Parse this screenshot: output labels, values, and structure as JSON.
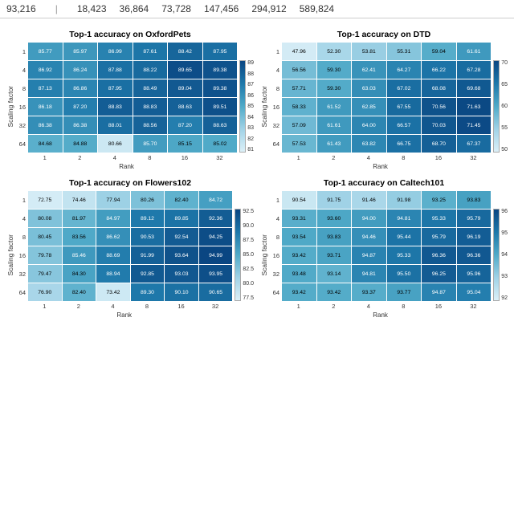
{
  "header": {
    "numbers": [
      "93,216",
      "18,423",
      "36,864",
      "73,728",
      "147,456",
      "294,912",
      "589,824"
    ]
  },
  "charts": [
    {
      "id": "oxfordpets",
      "title": "Top-1 accuracy on OxfordPets",
      "yLabel": "Scaling factor",
      "xLabel": "Rank",
      "rowLabels": [
        "1",
        "4",
        "8",
        "16",
        "32",
        "64"
      ],
      "colLabels": [
        "1",
        "2",
        "4",
        "8",
        "16",
        "32"
      ],
      "data": [
        [
          85.77,
          85.97,
          86.99,
          87.61,
          88.42,
          87.95
        ],
        [
          86.92,
          86.24,
          87.88,
          88.22,
          89.65,
          89.38
        ],
        [
          87.13,
          86.86,
          87.95,
          88.49,
          89.04,
          89.38
        ],
        [
          86.18,
          87.2,
          88.83,
          88.83,
          88.63,
          89.51
        ],
        [
          86.38,
          86.38,
          88.01,
          88.56,
          87.2,
          88.63
        ],
        [
          84.68,
          84.88,
          80.66,
          85.7,
          85.15,
          85.02
        ]
      ],
      "colorbarTicks": [
        "89",
        "88",
        "87",
        "86",
        "85",
        "84",
        "83",
        "82",
        "81"
      ],
      "colorMin": "#d4f0f7",
      "colorMax": "#0a4a7a",
      "minVal": 80,
      "maxVal": 90
    },
    {
      "id": "dtd",
      "title": "Top-1 accuracy on DTD",
      "yLabel": "Scaling factor",
      "xLabel": "Rank",
      "rowLabels": [
        "1",
        "4",
        "8",
        "16",
        "32",
        "64"
      ],
      "colLabels": [
        "1",
        "2",
        "4",
        "8",
        "16",
        "32"
      ],
      "data": [
        [
          47.96,
          52.3,
          53.81,
          55.31,
          59.04,
          61.61
        ],
        [
          56.56,
          59.3,
          62.41,
          64.27,
          66.22,
          67.28
        ],
        [
          57.71,
          59.3,
          63.03,
          67.02,
          68.08,
          69.68
        ],
        [
          58.33,
          61.52,
          62.85,
          67.55,
          70.56,
          71.63
        ],
        [
          57.09,
          61.61,
          64.0,
          66.57,
          70.03,
          71.45
        ],
        [
          57.53,
          61.43,
          63.82,
          66.75,
          68.7,
          67.37
        ]
      ],
      "colorbarTicks": [
        "70",
        "65",
        "60",
        "55",
        "50"
      ],
      "minVal": 47,
      "maxVal": 72
    },
    {
      "id": "flowers102",
      "title": "Top-1 accuracy on Flowers102",
      "yLabel": "Scaling factor",
      "xLabel": "Rank",
      "rowLabels": [
        "1",
        "4",
        "8",
        "16",
        "32",
        "64"
      ],
      "colLabels": [
        "1",
        "2",
        "4",
        "8",
        "16",
        "32"
      ],
      "data": [
        [
          72.75,
          74.46,
          77.94,
          80.26,
          82.4,
          84.72
        ],
        [
          80.08,
          81.97,
          84.97,
          89.12,
          89.85,
          92.36
        ],
        [
          80.45,
          83.56,
          86.62,
          90.53,
          92.54,
          94.25
        ],
        [
          79.78,
          85.46,
          88.69,
          91.99,
          93.64,
          94.99
        ],
        [
          79.47,
          84.3,
          88.94,
          92.85,
          93.03,
          93.95
        ],
        [
          76.9,
          82.4,
          73.42,
          89.3,
          90.1,
          90.65
        ]
      ],
      "colorbarTicks": [
        "92.5",
        "90.0",
        "87.5",
        "85.0",
        "82.5",
        "80.0",
        "77.5"
      ],
      "minVal": 72,
      "maxVal": 95
    },
    {
      "id": "caltech101",
      "title": "Top-1 accuracy on Caltech101",
      "yLabel": "Scaling factor",
      "xLabel": "Rank",
      "rowLabels": [
        "1",
        "4",
        "8",
        "16",
        "32",
        "64"
      ],
      "colLabels": [
        "1",
        "2",
        "4",
        "8",
        "16",
        "32"
      ],
      "data": [
        [
          90.54,
          91.75,
          91.46,
          91.98,
          93.25,
          93.83
        ],
        [
          93.31,
          93.6,
          94.0,
          94.81,
          95.33,
          95.79
        ],
        [
          93.54,
          93.83,
          94.46,
          95.44,
          95.79,
          96.19
        ],
        [
          93.42,
          93.71,
          94.87,
          95.33,
          96.36,
          96.36
        ],
        [
          93.48,
          93.14,
          94.81,
          95.5,
          96.25,
          95.96
        ],
        [
          93.42,
          93.42,
          93.37,
          93.77,
          94.87,
          95.04
        ]
      ],
      "colorbarTicks": [
        "96",
        "95",
        "94",
        "93",
        "92"
      ],
      "minVal": 90,
      "maxVal": 97
    }
  ]
}
